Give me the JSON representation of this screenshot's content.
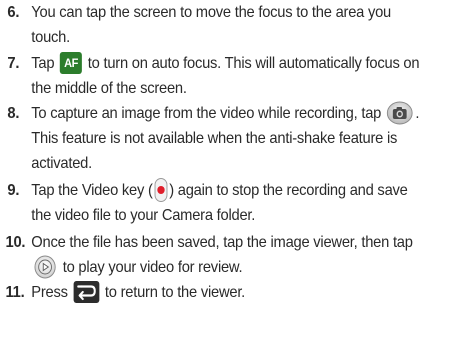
{
  "steps": [
    {
      "number": "6.",
      "text": "You can tap the screen to move the focus to the area you touch."
    },
    {
      "number": "7.",
      "before": "Tap ",
      "icon": "auto-focus-icon",
      "icon_label": "AF",
      "after": " to turn on auto focus. This will automatically focus on the middle of the screen."
    },
    {
      "number": "8.",
      "before": "To capture an image from the video while recording, tap ",
      "icon": "camera-icon",
      "after": ". This feature is not available when the anti-shake feature is activated."
    },
    {
      "number": "9.",
      "before": "Tap the Video key (",
      "icon": "record-key-icon",
      "after": ") again to stop the recording and save the video file to your Camera folder."
    },
    {
      "number": "10.",
      "before": "Once the file has been saved, tap the image viewer, then tap ",
      "icon": "play-icon",
      "after": " to play your video for review."
    },
    {
      "number": "11.",
      "before": "Press ",
      "icon": "back-icon",
      "after": " to return to the viewer."
    }
  ],
  "colors": {
    "text": "#2a2a2a",
    "af_icon_bg": "#2c7d2c",
    "record_red": "#e01e2b",
    "back_icon_bg": "#2c2c2c"
  }
}
